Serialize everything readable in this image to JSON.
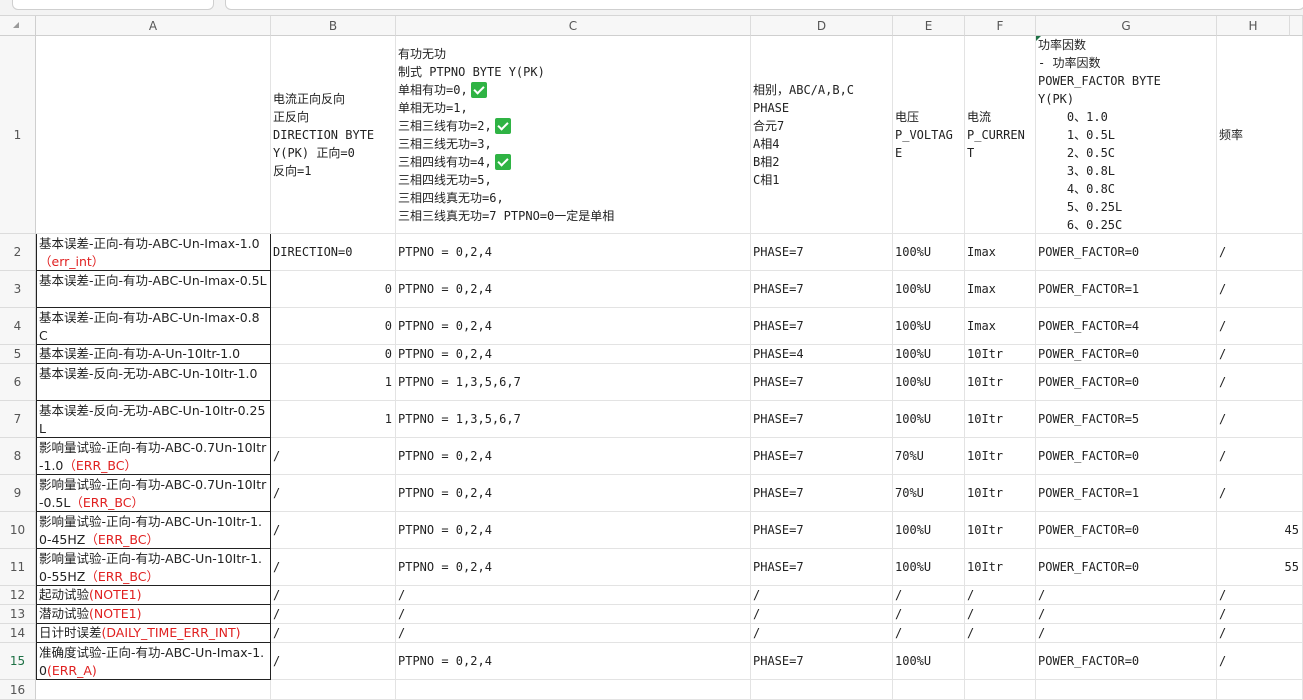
{
  "columns": [
    "A",
    "B",
    "C",
    "D",
    "E",
    "F",
    "G",
    "H"
  ],
  "header_row": {
    "row_num": "1",
    "B": [
      "电流正向反向",
      "正反向",
      "DIRECTION BYTE",
      "Y(PK) 正向=0",
      "反向=1"
    ],
    "C": [
      {
        "t": "有功无功",
        "check": false
      },
      {
        "t": "制式 PTPNO BYTE Y(PK)",
        "check": false
      },
      {
        "t": "单相有功=0,",
        "check": true
      },
      {
        "t": "单相无功=1,",
        "check": false
      },
      {
        "t": "三相三线有功=2,",
        "check": true
      },
      {
        "t": "三相三线无功=3,",
        "check": false
      },
      {
        "t": "三相四线有功=4,",
        "check": true
      },
      {
        "t": "三相四线无功=5,",
        "check": false
      },
      {
        "t": "三相四线真无功=6,",
        "check": false
      },
      {
        "t": "三相三线真无功=7 PTPNO=0一定是单相",
        "check": false
      }
    ],
    "D": [
      "相别，ABC/A,B,C",
      "PHASE",
      "合元7",
      "A相4",
      "B相2",
      "C相1"
    ],
    "E": [
      "电压",
      "P_VOLTAG",
      "E"
    ],
    "F": [
      "电流",
      "P_CURREN",
      "T"
    ],
    "G": [
      "功率因数",
      "- 功率因数",
      "POWER_FACTOR BYTE",
      "Y(PK)",
      "    0、1.0",
      "    1、0.5L",
      "    2、0.5C",
      "    3、0.8L",
      "    4、0.8C",
      "    5、0.25L",
      "    6、0.25C"
    ],
    "H": [
      "频率"
    ]
  },
  "rows": [
    {
      "n": "2",
      "a": "基本误差-正向-有功-ABC-Un-Imax-1.0",
      "a_red": "（err_int）",
      "b": "DIRECTION=0",
      "c": "PTPNO = 0,2,4",
      "d": "PHASE=7",
      "e": "100%U",
      "f": "Imax",
      "g": "POWER_FACTOR=0",
      "h": "/"
    },
    {
      "n": "3",
      "a": "基本误差-正向-有功-ABC-Un-Imax-0.5L",
      "a_red": "",
      "b": "0",
      "c": "PTPNO = 0,2,4",
      "d": "PHASE=7",
      "e": "100%U",
      "f": "Imax",
      "g": "POWER_FACTOR=1",
      "h": "/"
    },
    {
      "n": "4",
      "a": "基本误差-正向-有功-ABC-Un-Imax-0.8C",
      "a_red": "",
      "b": "0",
      "c": "PTPNO = 0,2,4",
      "d": "PHASE=7",
      "e": "100%U",
      "f": "Imax",
      "g": "POWER_FACTOR=4",
      "h": "/"
    },
    {
      "n": "5",
      "a": "基本误差-正向-有功-A-Un-10Itr-1.0",
      "a_red": "",
      "b": "0",
      "c": "PTPNO = 0,2,4",
      "d": "PHASE=4",
      "e": "100%U",
      "f": "10Itr",
      "g": "POWER_FACTOR=0",
      "h": "/"
    },
    {
      "n": "6",
      "a": "基本误差-反向-无功-ABC-Un-10Itr-1.0",
      "a_red": "",
      "b": "1",
      "c": "PTPNO = 1,3,5,6,7",
      "d": "PHASE=7",
      "e": "100%U",
      "f": "10Itr",
      "g": "POWER_FACTOR=0",
      "h": "/"
    },
    {
      "n": "7",
      "a": "基本误差-反向-无功-ABC-Un-10Itr-0.25L",
      "a_red": "",
      "b": "1",
      "c": "PTPNO = 1,3,5,6,7",
      "d": "PHASE=7",
      "e": "100%U",
      "f": "10Itr",
      "g": "POWER_FACTOR=5",
      "h": "/"
    },
    {
      "n": "8",
      "a": "影响量试验-正向-有功-ABC-0.7Un-10Itr-1.0",
      "a_red": "（ERR_BC）",
      "b": "/",
      "c": "PTPNO = 0,2,4",
      "d": "PHASE=7",
      "e": "70%U",
      "f": "10Itr",
      "g": "POWER_FACTOR=0",
      "h": "/"
    },
    {
      "n": "9",
      "a": "影响量试验-正向-有功-ABC-0.7Un-10Itr-0.5L",
      "a_red": "（ERR_BC）",
      "b": "/",
      "c": "PTPNO = 0,2,4",
      "d": "PHASE=7",
      "e": "70%U",
      "f": "10Itr",
      "g": "POWER_FACTOR=1",
      "h": "/"
    },
    {
      "n": "10",
      "a": "影响量试验-正向-有功-ABC-Un-10Itr-1.0-45HZ",
      "a_red": "（ERR_BC）",
      "b": "/",
      "c": "PTPNO = 0,2,4",
      "d": "PHASE=7",
      "e": "100%U",
      "f": "10Itr",
      "g": "POWER_FACTOR=0",
      "h": "45"
    },
    {
      "n": "11",
      "a": "影响量试验-正向-有功-ABC-Un-10Itr-1.0-55HZ",
      "a_red": "（ERR_BC）",
      "b": "/",
      "c": "PTPNO = 0,2,4",
      "d": "PHASE=7",
      "e": "100%U",
      "f": "10Itr",
      "g": "POWER_FACTOR=0",
      "h": "55"
    },
    {
      "n": "12",
      "a": "起动试验",
      "a_red": "(NOTE1)",
      "b": "/",
      "c": "/",
      "d": "/",
      "e": "/",
      "f": "/",
      "g": "/",
      "h": "/"
    },
    {
      "n": "13",
      "a": "潜动试验",
      "a_red": "(NOTE1)",
      "b": "/",
      "c": "/",
      "d": "/",
      "e": "/",
      "f": "/",
      "g": "/",
      "h": "/"
    },
    {
      "n": "14",
      "a": "日计时误差",
      "a_red": "(DAILY_TIME_ERR_INT)",
      "b": "/",
      "c": "/",
      "d": "/",
      "e": "/",
      "f": "/",
      "g": "/",
      "h": "/"
    },
    {
      "n": "15",
      "a": "准确度试验-正向-有功-ABC-Un-Imax-1.0",
      "a_red": "(ERR_A)",
      "b": "/",
      "c": "PTPNO = 0,2,4",
      "d": "PHASE=7",
      "e": "100%U",
      "f": "",
      "g": "POWER_FACTOR=0",
      "h": "/"
    },
    {
      "n": "16",
      "a": "",
      "a_red": "",
      "b": "",
      "c": "",
      "d": "",
      "e": "",
      "f": "",
      "g": "",
      "h": ""
    }
  ],
  "selected_row": "15"
}
